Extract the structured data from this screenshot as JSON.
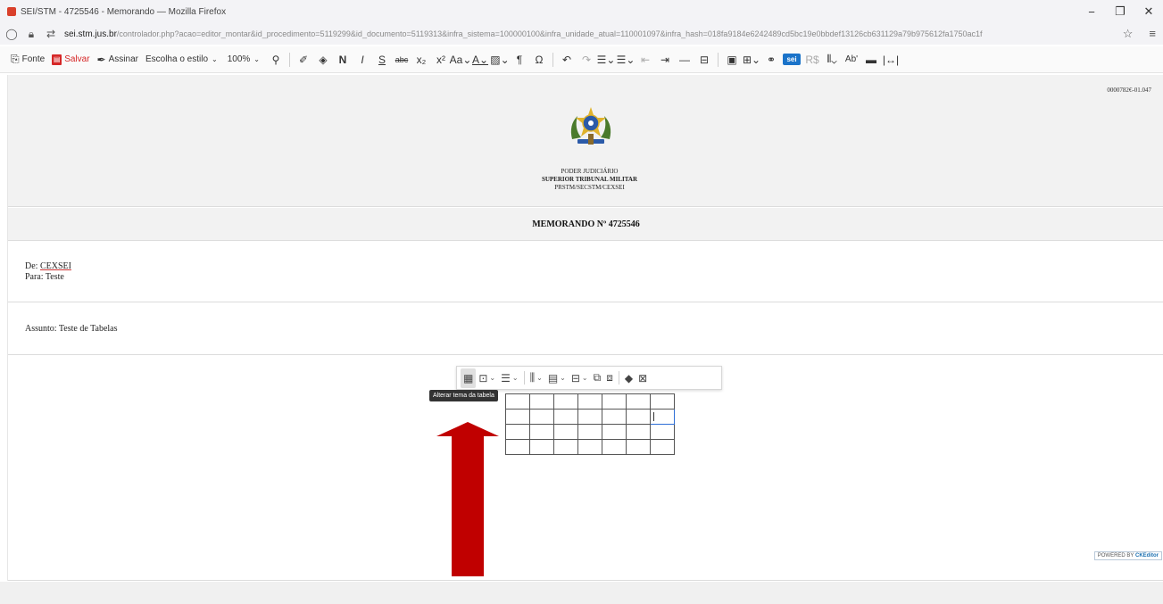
{
  "browser": {
    "title": "SEI/STM - 4725546 - Memorando — Mozilla Firefox",
    "url_domain": "sei.stm.jus.br",
    "url_path": "/controlador.php?acao=editor_montar&id_procedimento=5119299&id_documento=5119313&infra_sistema=100000100&infra_unidade_atual=110001097&infra_hash=018fa9184e6242489cd5bc19e0bbdef13126cb631129a79b975612fa1750ac1f",
    "minimize": "−",
    "restore": "❐",
    "close": "✕",
    "colors": {
      "chrome_bg": "#f3f3f6"
    }
  },
  "toolbar": {
    "fonte_label": "Fonte",
    "salvar_label": "Salvar",
    "assinar_label": "Assinar",
    "style_label": "Escolha o estilo",
    "zoom_label": "100%",
    "colors": {
      "save": "#d62828",
      "sei_badge": "#1a73c9"
    }
  },
  "document": {
    "number": "0000782€-01.047",
    "org_line1": "PODER JUDICIÁRIO",
    "org_line2": "SUPERIOR TRIBUNAL MILITAR",
    "org_line3": "PRSTM/SECSTM/CEXSEI",
    "memo_title": "MEMORANDO Nº 4725546",
    "from_label": "De: ",
    "from_value": "CEXSEI",
    "to_text": "Para: Teste",
    "subject_text": "Assunto: Teste de Tabelas"
  },
  "table_toolbar": {
    "tooltip": "Alterar tema da tabela",
    "icons": [
      "table-theme-icon",
      "table-properties-icon",
      "table-align-icon",
      "table-columns-icon",
      "table-rows-icon",
      "table-merge-icon",
      "cell-insert-icon",
      "cell-delete-icon",
      "eraser-icon",
      "remove-table-icon"
    ]
  },
  "table": {
    "rows": 4,
    "cols": 7,
    "selected_cell": {
      "row": 1,
      "col": 6
    }
  },
  "footer": {
    "powered_label": "POWERED BY",
    "powered_brand": "CKEditor"
  },
  "annotation": {
    "arrow_color": "#c00000"
  }
}
